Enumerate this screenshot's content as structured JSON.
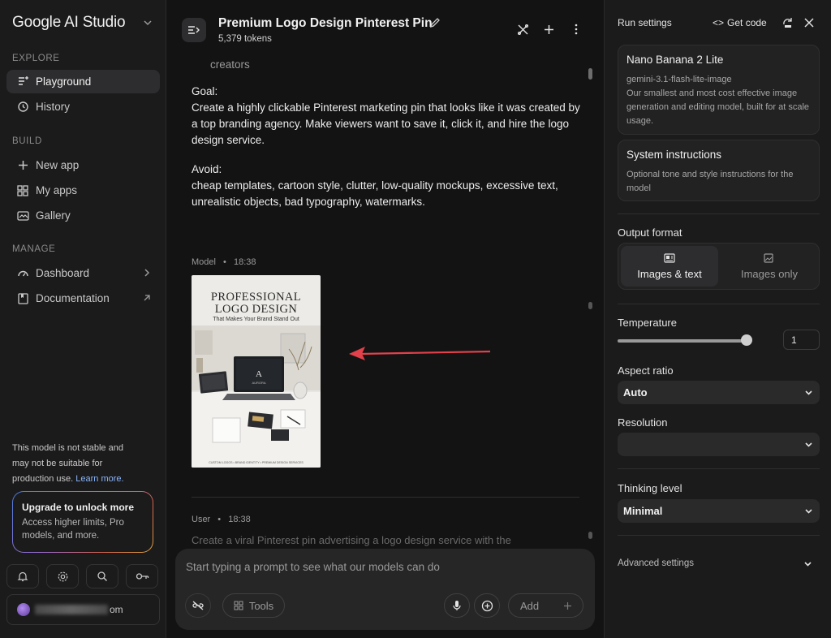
{
  "sidebar": {
    "brand": "Google AI Studio",
    "sections": {
      "explore": "EXPLORE",
      "build": "BUILD",
      "manage": "MANAGE"
    },
    "items": {
      "playground": "Playground",
      "history": "History",
      "new_app": "New app",
      "my_apps": "My apps",
      "gallery": "Gallery",
      "dashboard": "Dashboard",
      "documentation": "Documentation"
    },
    "warning": {
      "text": "This model is not stable and may not be suitable for production use.",
      "link": "Learn more."
    },
    "upgrade": {
      "title": "Upgrade to unlock more",
      "desc": "Access higher limits, Pro models, and more."
    },
    "account_suffix": "om"
  },
  "main": {
    "title": "Premium Logo Design Pinterest Pin",
    "tokens": "5,379 tokens",
    "faded_top": "creators",
    "goal_label": "Goal:",
    "goal_text": "Create a highly clickable Pinterest marketing pin that looks like it was created by a top branding agency. Make viewers want to save it, click it, and hire the logo design service.",
    "avoid_label": "Avoid:",
    "avoid_text": "cheap templates, cartoon style, clutter, low-quality mockups, excessive text, unrealistic objects, bad typography, watermarks.",
    "model_meta": {
      "role": "Model",
      "time": "18:38"
    },
    "pin": {
      "line1": "PROFESSIONAL",
      "line2": "LOGO DESIGN",
      "subtitle": "That Makes Your Brand Stand Out",
      "brand_letter": "A",
      "brand_name": "AURORA",
      "footer": "CUSTOM LOGOS • BRAND IDENTITY • PREMIUM DESIGN SERVICES"
    },
    "user_meta": {
      "role": "User",
      "time": "18:38"
    },
    "user_preview": "Create a viral Pinterest pin advertising a logo design service with the",
    "composer": {
      "placeholder": "Start typing a prompt to see what our models can do",
      "tools": "Tools",
      "add": "Add"
    }
  },
  "right": {
    "title": "Run settings",
    "get_code": "Get code",
    "model": {
      "name": "Nano Banana 2 Lite",
      "id": "gemini-3.1-flash-lite-image",
      "desc": "Our smallest and most cost effective image generation and editing model, built for at scale usage."
    },
    "system": {
      "title": "System instructions",
      "desc": "Optional tone and style instructions for the model"
    },
    "output_format": {
      "label": "Output format",
      "images_text": "Images & text",
      "images_only": "Images only"
    },
    "temperature": {
      "label": "Temperature",
      "value": "1",
      "level": 1.0
    },
    "aspect_ratio": {
      "label": "Aspect ratio",
      "value": "Auto"
    },
    "resolution": {
      "label": "Resolution",
      "value": ""
    },
    "thinking": {
      "label": "Thinking level",
      "value": "Minimal"
    },
    "advanced": "Advanced settings"
  },
  "colors": {
    "accent_link": "#8ab4f8",
    "arrow": "#e2404b",
    "bg": "#131314",
    "panel": "#1b1b1c"
  }
}
